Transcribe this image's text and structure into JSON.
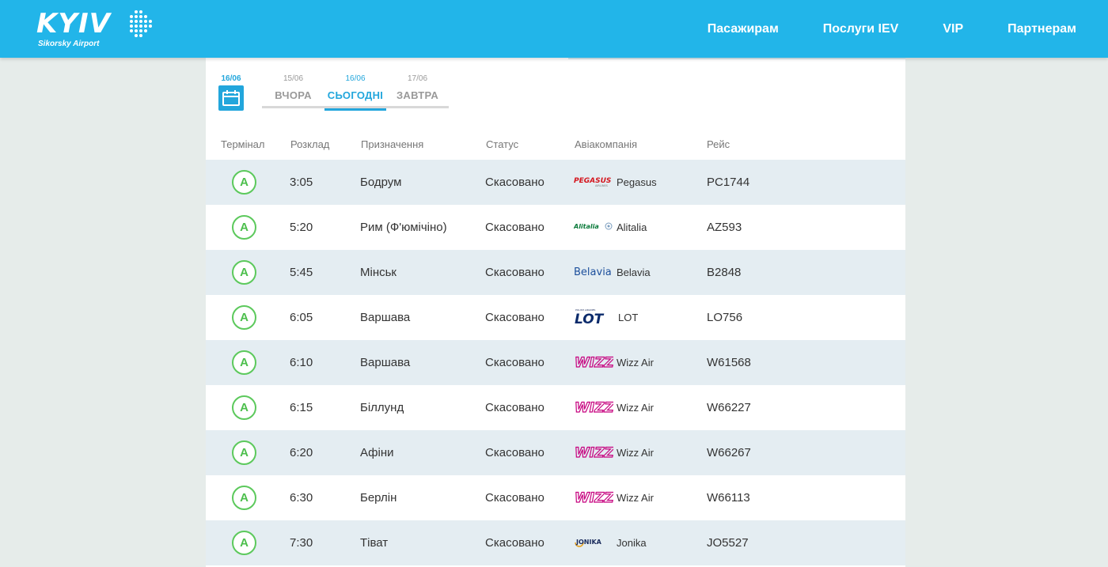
{
  "header": {
    "logo_text": "KYIV",
    "logo_sub": "Sikorsky Airport",
    "nav": [
      "Пасажирам",
      "Послуги IEV",
      "VIP",
      "Партнерам"
    ]
  },
  "date_selector": {
    "calendar_date": "16/06",
    "tabs": [
      {
        "date": "15/06",
        "label": "ВЧОРА",
        "active": false
      },
      {
        "date": "16/06",
        "label": "СЬОГОДНІ",
        "active": true
      },
      {
        "date": "17/06",
        "label": "ЗАВТРА",
        "active": false
      }
    ]
  },
  "table": {
    "columns": [
      "Термінал",
      "Розклад",
      "Призначення",
      "Статус",
      "Авіакомпанія",
      "Рейс"
    ],
    "rows": [
      {
        "terminal": "A",
        "time": "3:05",
        "destination": "Бодрум",
        "status": "Скасовано",
        "airline": "Pegasus",
        "airline_logo": "pegasus-logo",
        "flight": "PC1744"
      },
      {
        "terminal": "A",
        "time": "5:20",
        "destination": "Рим (Ф'юмічіно)",
        "status": "Скасовано",
        "airline": "Alitalia",
        "airline_logo": "alitalia-logo",
        "flight": "AZ593"
      },
      {
        "terminal": "A",
        "time": "5:45",
        "destination": "Мінськ",
        "status": "Скасовано",
        "airline": "Belavia",
        "airline_logo": "belavia-logo",
        "flight": "B2848"
      },
      {
        "terminal": "A",
        "time": "6:05",
        "destination": "Варшава",
        "status": "Скасовано",
        "airline": "LOT",
        "airline_logo": "lot-logo",
        "flight": "LO756"
      },
      {
        "terminal": "A",
        "time": "6:10",
        "destination": "Варшава",
        "status": "Скасовано",
        "airline": "Wizz Air",
        "airline_logo": "wizz-logo",
        "flight": "W61568"
      },
      {
        "terminal": "A",
        "time": "6:15",
        "destination": "Біллунд",
        "status": "Скасовано",
        "airline": "Wizz Air",
        "airline_logo": "wizz-logo",
        "flight": "W66227"
      },
      {
        "terminal": "A",
        "time": "6:20",
        "destination": "Афіни",
        "status": "Скасовано",
        "airline": "Wizz Air",
        "airline_logo": "wizz-logo",
        "flight": "W66267"
      },
      {
        "terminal": "A",
        "time": "6:30",
        "destination": "Берлін",
        "status": "Скасовано",
        "airline": "Wizz Air",
        "airline_logo": "wizz-logo",
        "flight": "W66113"
      },
      {
        "terminal": "A",
        "time": "7:30",
        "destination": "Тіват",
        "status": "Скасовано",
        "airline": "Jonika",
        "airline_logo": "jonika-logo",
        "flight": "JO5527"
      }
    ]
  },
  "colors": {
    "header_bg": "#22b5e9",
    "accent": "#22a6dc",
    "terminal_green": "#4cbf4c",
    "row_alt": "#e4edf2",
    "page_bg": "#e6ecea"
  }
}
